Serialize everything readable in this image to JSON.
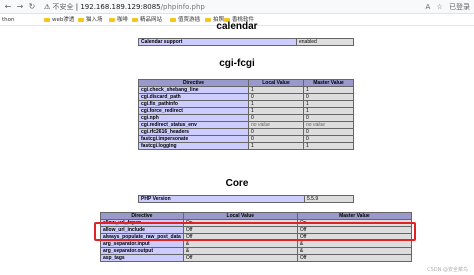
{
  "browser": {
    "secure_label": "不安全",
    "url_host": "192.168.189.129:8085",
    "url_path": "/phpinfo.php",
    "aa_label": "A",
    "profile_label": "已登录"
  },
  "bookmarks": [
    {
      "label": "thon"
    },
    {
      "label": "web渗透"
    },
    {
      "label": "猫入场"
    },
    {
      "label": "咖啡"
    },
    {
      "label": "精品网站"
    },
    {
      "label": "值贾游插"
    },
    {
      "label": "拍照"
    },
    {
      "label": "香桃软件"
    }
  ],
  "calendar": {
    "title": "calendar",
    "rows": [
      {
        "name": "Calendar support",
        "value": "enabled"
      }
    ]
  },
  "cgi": {
    "title": "cgi-fcgi",
    "headers": [
      "Directive",
      "Local Value",
      "Master Value"
    ],
    "rows": [
      {
        "name": "cgi.check_shebang_line",
        "local": "1",
        "master": "1",
        "nv": false
      },
      {
        "name": "cgi.discard_path",
        "local": "0",
        "master": "0",
        "nv": false
      },
      {
        "name": "cgi.fix_pathinfo",
        "local": "1",
        "master": "1",
        "nv": false
      },
      {
        "name": "cgi.force_redirect",
        "local": "1",
        "master": "1",
        "nv": false
      },
      {
        "name": "cgi.nph",
        "local": "0",
        "master": "0",
        "nv": false
      },
      {
        "name": "cgi.redirect_status_env",
        "local": "no value",
        "master": "no value",
        "nv": true
      },
      {
        "name": "cgi.rfc2616_headers",
        "local": "0",
        "master": "0",
        "nv": false
      },
      {
        "name": "fastcgi.impersonate",
        "local": "0",
        "master": "0",
        "nv": false
      },
      {
        "name": "fastcgi.logging",
        "local": "1",
        "master": "1",
        "nv": false
      }
    ]
  },
  "core": {
    "title": "Core",
    "php_version_label": "PHP Version",
    "php_version": "5.5.9",
    "headers": [
      "Directive",
      "Local Value",
      "Master Value"
    ],
    "rows": [
      {
        "name": "allow_url_fopen",
        "local": "On",
        "master": "On"
      },
      {
        "name": "allow_url_include",
        "local": "Off",
        "master": "Off"
      },
      {
        "name": "always_populate_raw_post_data",
        "local": "Off",
        "master": "Off"
      },
      {
        "name": "arg_separator.input",
        "local": "&",
        "master": "&"
      },
      {
        "name": "arg_separator.output",
        "local": "&",
        "master": "&"
      },
      {
        "name": "asp_tags",
        "local": "Off",
        "master": "Off"
      }
    ]
  },
  "watermark": "CSDN @安全菜鸟"
}
